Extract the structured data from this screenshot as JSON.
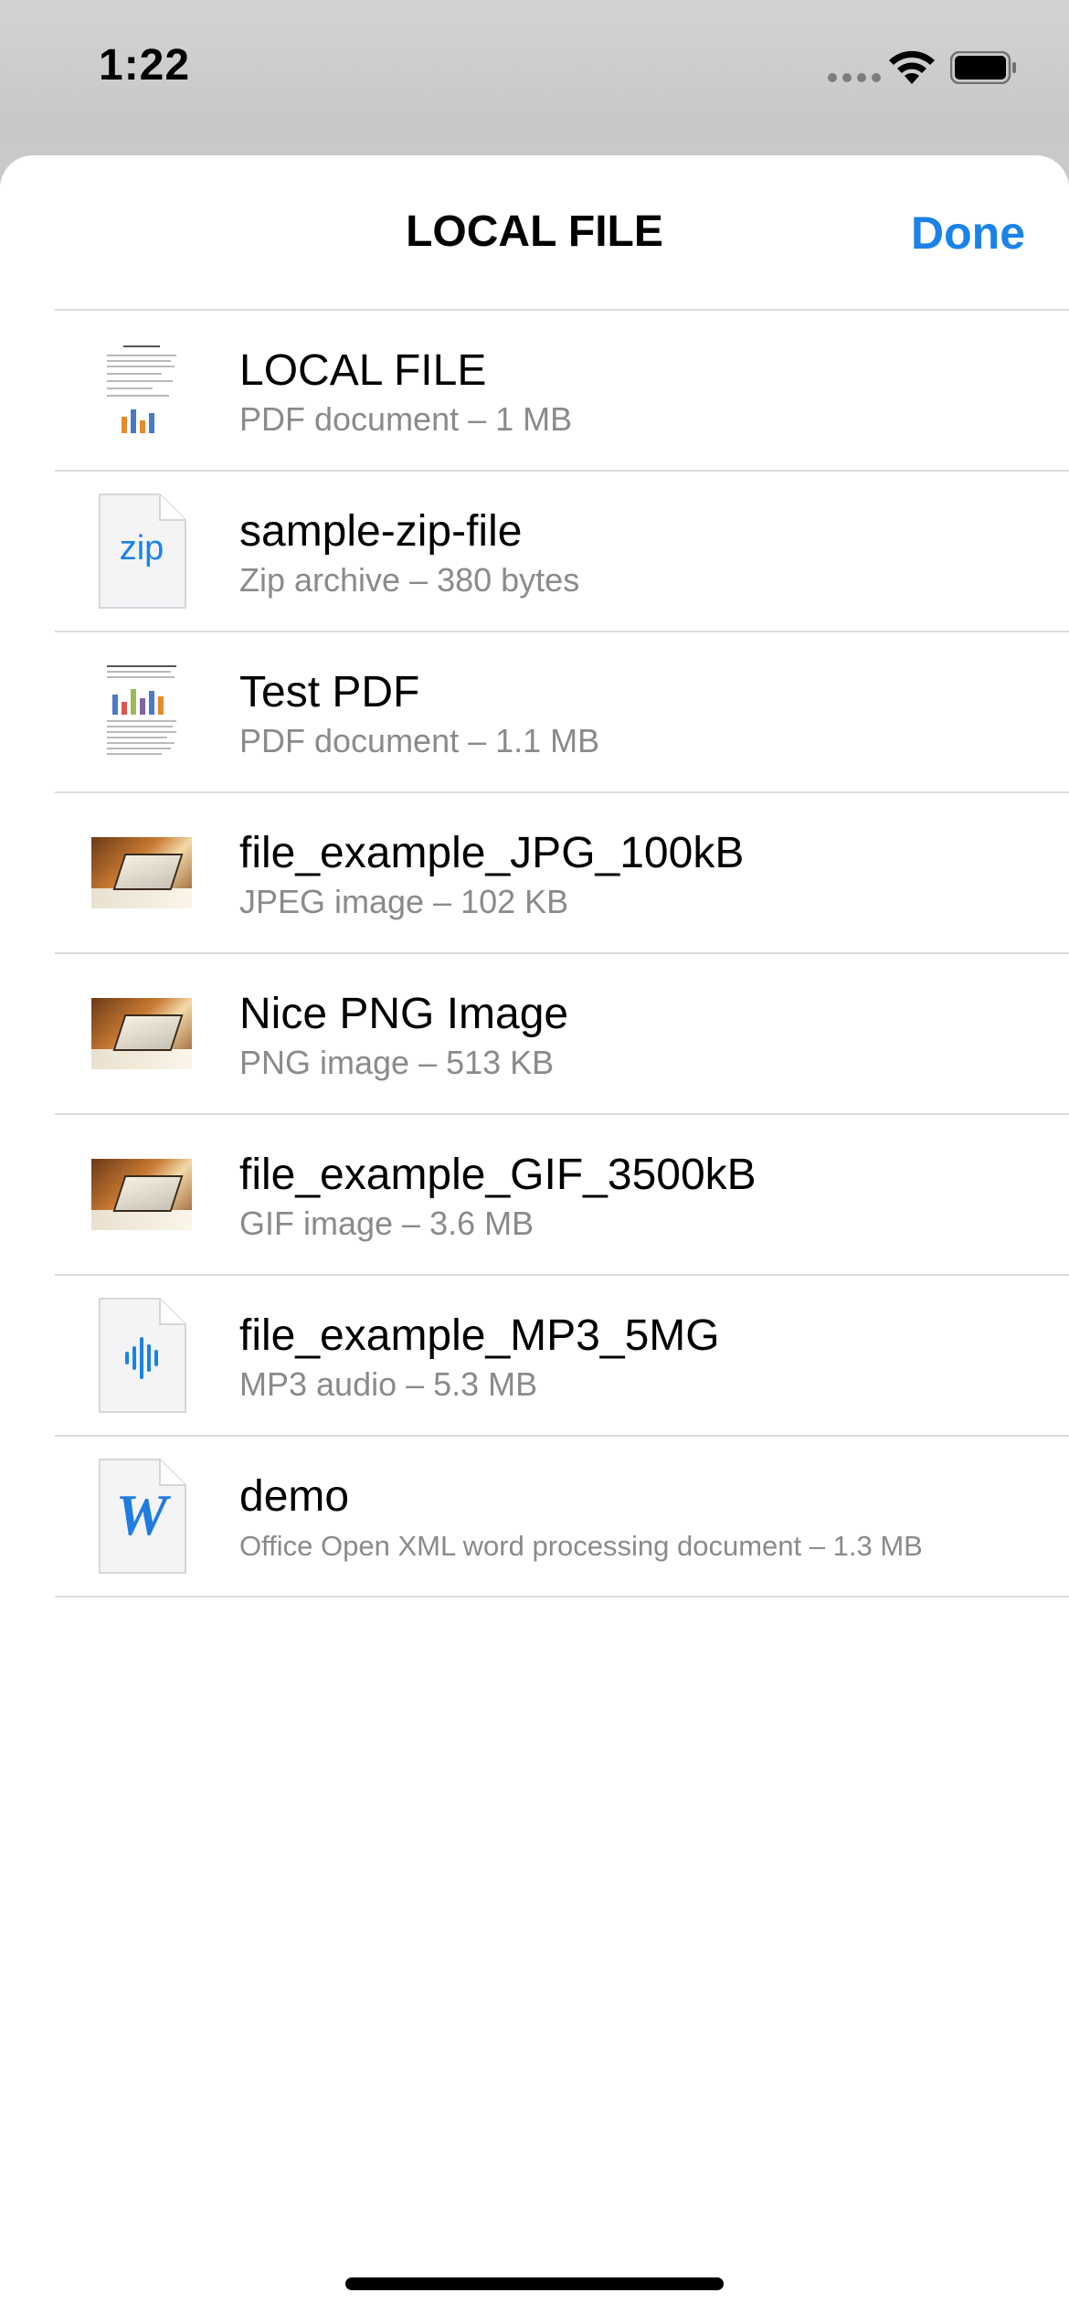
{
  "status": {
    "time": "1:22"
  },
  "sheet": {
    "title": "LOCAL FILE",
    "done_label": "Done"
  },
  "files": [
    {
      "name": "LOCAL FILE",
      "detail": "PDF document – 1 MB",
      "icon": "pdf-thumbnail"
    },
    {
      "name": "sample-zip-file",
      "detail": "Zip archive – 380 bytes",
      "icon": "zip-file-icon",
      "icon_text": "zip"
    },
    {
      "name": "Test PDF",
      "detail": "PDF document – 1.1 MB",
      "icon": "pdf-thumbnail"
    },
    {
      "name": "file_example_JPG_100kB",
      "detail": "JPEG image – 102 KB",
      "icon": "image-thumbnail"
    },
    {
      "name": "Nice PNG Image",
      "detail": "PNG image – 513 KB",
      "icon": "image-thumbnail"
    },
    {
      "name": "file_example_GIF_3500kB",
      "detail": "GIF image – 3.6 MB",
      "icon": "image-thumbnail"
    },
    {
      "name": "file_example_MP3_5MG",
      "detail": "MP3 audio – 5.3 MB",
      "icon": "audio-file-icon"
    },
    {
      "name": "demo",
      "detail": "Office Open XML word processing document – 1.3 MB",
      "icon": "word-file-icon",
      "icon_text": "W"
    }
  ],
  "colors": {
    "accent": "#1a82e8",
    "secondary_text": "#8a8a8e",
    "separator": "#dcdcdf"
  }
}
